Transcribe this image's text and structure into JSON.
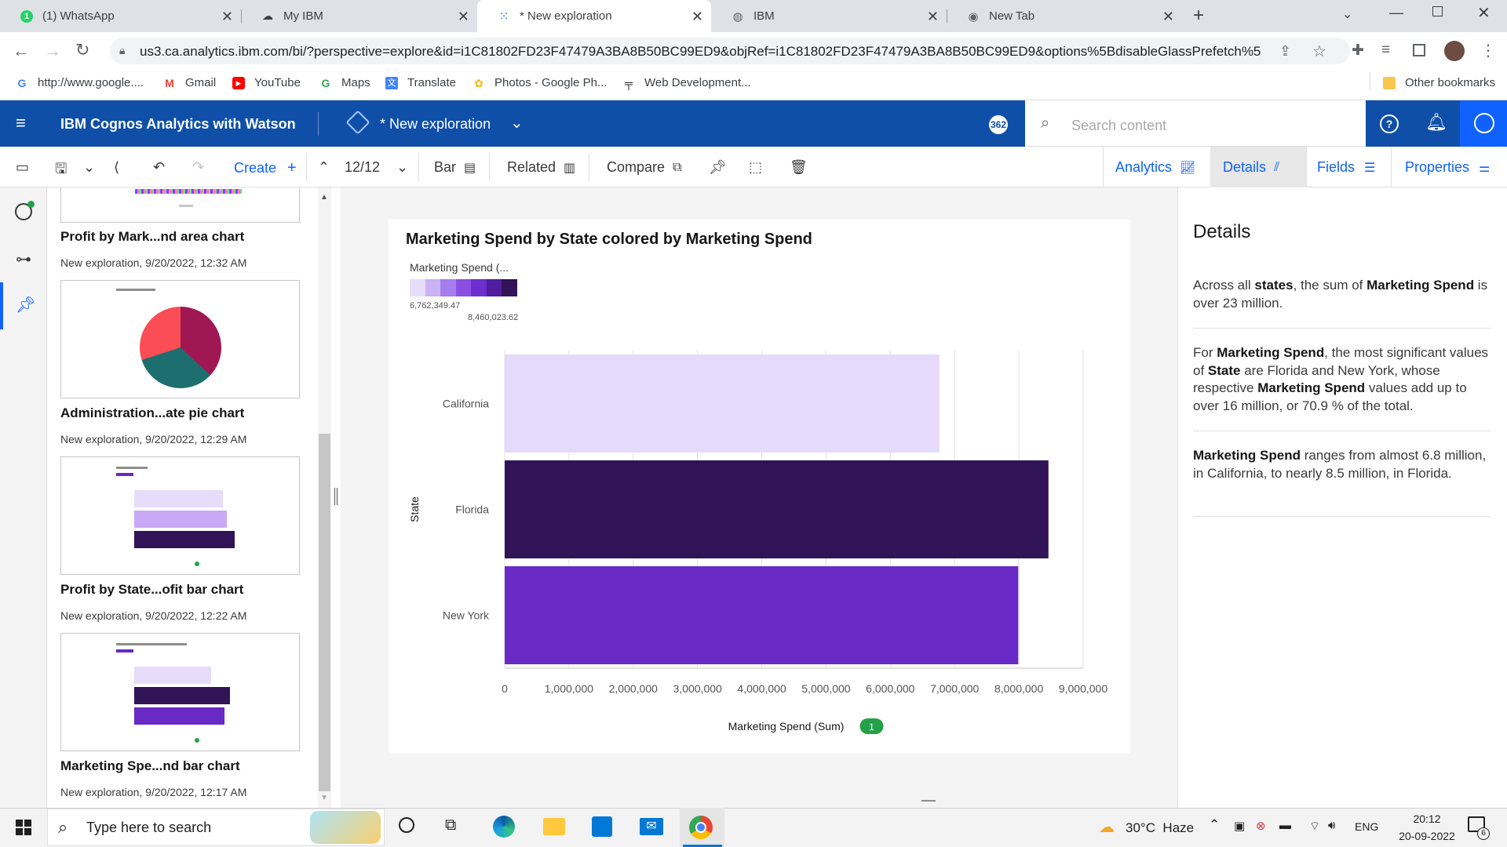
{
  "browser": {
    "tabs": [
      {
        "title": "(1) WhatsApp",
        "active": false
      },
      {
        "title": "My IBM",
        "active": false
      },
      {
        "title": "* New exploration",
        "active": true
      },
      {
        "title": "IBM",
        "active": false
      },
      {
        "title": "New Tab",
        "active": false
      }
    ],
    "url": "us3.ca.analytics.ibm.com/bi/?perspective=explore&id=i1C81802FD23F47479A3BA8B50BC99ED9&objRef=i1C81802FD23F47479A3BA8B50BC99ED9&options%5BdisableGlassPrefetch%5...",
    "bookmarks": [
      {
        "label": "http://www.google...."
      },
      {
        "label": "Gmail"
      },
      {
        "label": "YouTube"
      },
      {
        "label": "Maps"
      },
      {
        "label": "Translate"
      },
      {
        "label": "Photos - Google Ph..."
      },
      {
        "label": "Web Development..."
      }
    ],
    "other_bookmarks": "Other bookmarks"
  },
  "app": {
    "title": "IBM Cognos Analytics with Watson",
    "exploration_name": "* New exploration",
    "notification_count": "362",
    "search_placeholder": "Search content"
  },
  "toolbar": {
    "create": "Create",
    "page_counter": "12/12",
    "bar": "Bar",
    "related": "Related",
    "compare": "Compare",
    "analytics": "Analytics",
    "details": "Details",
    "fields": "Fields",
    "properties": "Properties"
  },
  "cards": [
    {
      "title": "Profit by Mark...nd area chart",
      "subtitle": "New exploration, 9/20/2022, 12:32 AM"
    },
    {
      "title": "Administration...ate pie chart",
      "subtitle": "New exploration, 9/20/2022, 12:29 AM"
    },
    {
      "title": "Profit by State...ofit bar chart",
      "subtitle": "New exploration, 9/20/2022, 12:22 AM"
    },
    {
      "title": "Marketing Spe...nd bar chart",
      "subtitle": "New exploration, 9/20/2022, 12:17 AM"
    }
  ],
  "chart_data": {
    "type": "bar",
    "orientation": "horizontal",
    "title": "Marketing Spend by State colored by Marketing Spend",
    "legend_title": "Marketing Spend (...",
    "legend_min": "6,762,349.47",
    "legend_max": "8,460,023.62",
    "legend_colors": [
      "#e8dcfb",
      "#c9b2f5",
      "#a67ded",
      "#8a4fe0",
      "#6d2ed0",
      "#4f1d9e",
      "#311358"
    ],
    "categories": [
      "California",
      "Florida",
      "New York"
    ],
    "values": [
      6762349.47,
      8460023.62,
      7990000
    ],
    "colors": [
      "#e6dafb",
      "#311358",
      "#6929c4"
    ],
    "ylabel": "State",
    "xlabel": "Marketing Spend (Sum)",
    "xlabel_badge": "1",
    "xlim": [
      0,
      9000000
    ],
    "x_ticks": [
      "0",
      "1,000,000",
      "2,000,000",
      "3,000,000",
      "4,000,000",
      "5,000,000",
      "6,000,000",
      "7,000,000",
      "8,000,000",
      "9,000,000"
    ],
    "grid": true
  },
  "details": {
    "heading": "Details",
    "p1": {
      "a": "Across all ",
      "b": "states",
      "c": ", the sum of ",
      "d": "Marketing Spend",
      "e": " is over 23 million."
    },
    "p2": {
      "a": "For ",
      "b": "Marketing Spend",
      "c": ", the most significant values of ",
      "d": "State",
      "e": " are Florida and New York, whose respective ",
      "f": "Marketing Spend",
      "g": " values add up to over 16 million, or 70.9 % of the total."
    },
    "p3": {
      "a": "Marketing Spend",
      "b": " ranges from almost 6.8 million, in California, to nearly 8.5 million, in Florida."
    }
  },
  "taskbar": {
    "search_placeholder": "Type here to search",
    "weather": "30°C  Haze",
    "lang": "ENG",
    "time": "20:12",
    "date": "20-09-2022",
    "notif_count": "6"
  }
}
